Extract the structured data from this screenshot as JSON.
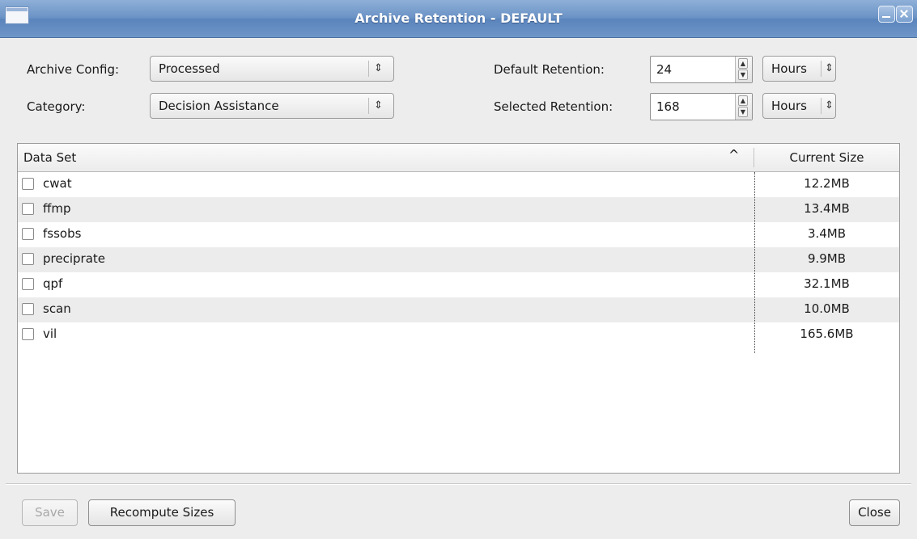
{
  "window": {
    "title": "Archive Retention - DEFAULT"
  },
  "form": {
    "archive_config_label": "Archive Config:",
    "archive_config_value": "Processed",
    "category_label": "Category:",
    "category_value": "Decision Assistance",
    "default_retention_label": "Default Retention:",
    "default_retention_value": "24",
    "default_retention_unit": "Hours",
    "selected_retention_label": "Selected Retention:",
    "selected_retention_value": "168",
    "selected_retention_unit": "Hours"
  },
  "table": {
    "columns": [
      "Data Set",
      "Current Size"
    ],
    "sort_indicator": "^",
    "rows": [
      {
        "name": "cwat",
        "size": "12.2MB"
      },
      {
        "name": "ffmp",
        "size": "13.4MB"
      },
      {
        "name": "fssobs",
        "size": "3.4MB"
      },
      {
        "name": "preciprate",
        "size": "9.9MB"
      },
      {
        "name": "qpf",
        "size": "32.1MB"
      },
      {
        "name": "scan",
        "size": "10.0MB"
      },
      {
        "name": "vil",
        "size": "165.6MB"
      }
    ]
  },
  "buttons": {
    "save": "Save",
    "recompute": "Recompute Sizes",
    "close": "Close"
  },
  "glyphs": {
    "updown": "⇕",
    "spin_up": "▲",
    "spin_down": "▼"
  },
  "colors": {
    "titlebar": "#6a92c5",
    "window_bg": "#ededed",
    "alt_row": "#ececec"
  }
}
